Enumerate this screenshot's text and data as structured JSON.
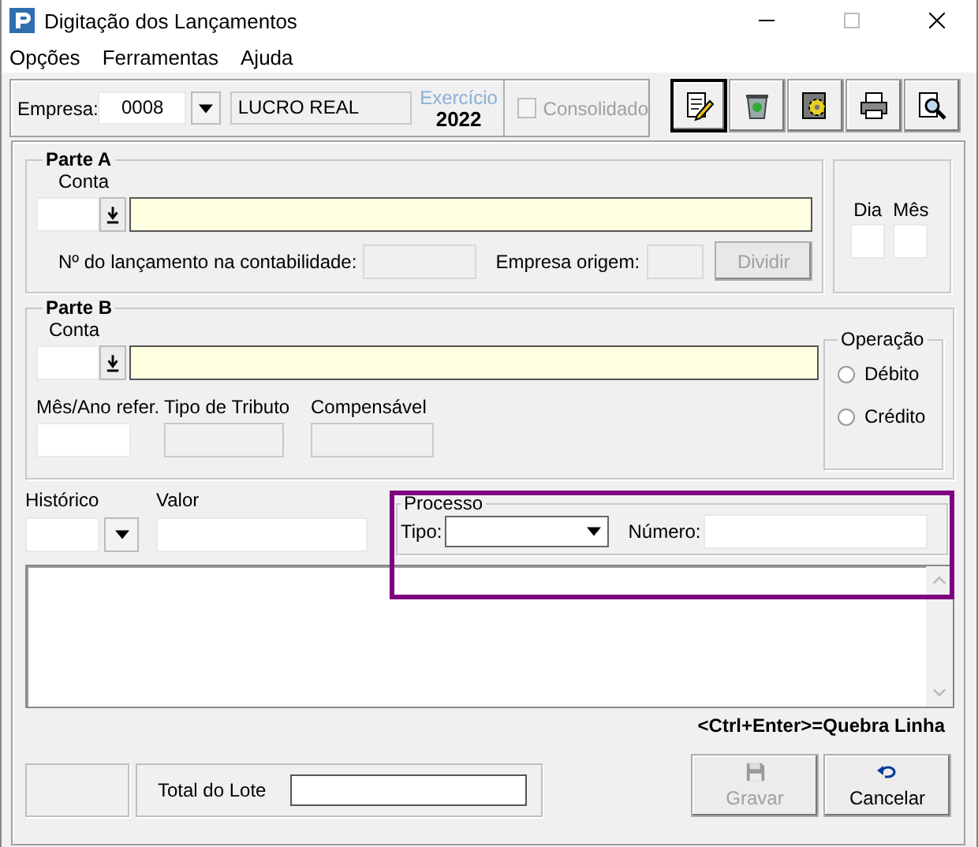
{
  "window": {
    "title": "Digitação dos Lançamentos"
  },
  "menu": [
    "Opções",
    "Ferramentas",
    "Ajuda"
  ],
  "header": {
    "empresa_label": "Empresa:",
    "empresa_value": "0008",
    "regime": "LUCRO REAL",
    "exercicio_label": "Exercício",
    "exercicio_value": "2022",
    "consolidado": {
      "label": "Consolidado",
      "checked": false,
      "disabled": true
    }
  },
  "toolbar": [
    {
      "kind": "edit",
      "selected": true
    },
    {
      "kind": "trash",
      "selected": false
    },
    {
      "kind": "gear",
      "selected": false
    },
    {
      "kind": "print",
      "selected": false
    },
    {
      "kind": "search",
      "selected": false
    }
  ],
  "parte_a": {
    "title": "Parte A",
    "conta_label": "Conta",
    "lancamento_label": "Nº do lançamento na contabilidade:",
    "empresa_origem_label": "Empresa origem:",
    "dividir": {
      "label": "Dividir",
      "disabled": true
    }
  },
  "data": {
    "dia_label": "Dia",
    "mes_label": "Mês"
  },
  "parte_b": {
    "title": "Parte B",
    "conta_label": "Conta",
    "mes_ano_label": "Mês/Ano refer.",
    "tipo_tributo_label": "Tipo de Tributo",
    "compensavel_label": "Compensável",
    "operacao": {
      "title": "Operação",
      "options": [
        {
          "label": "Débito",
          "selected": false
        },
        {
          "label": "Crédito",
          "selected": false
        }
      ]
    }
  },
  "historico_label": "Histórico",
  "valor_label": "Valor",
  "processo": {
    "title": "Processo",
    "tipo_label": "Tipo:",
    "numero_label": "Número:"
  },
  "hint": "<Ctrl+Enter>=Quebra Linha",
  "total_label": "Total do Lote",
  "buttons": [
    {
      "label": "Gravar",
      "kind": "save",
      "disabled": true
    },
    {
      "label": "Cancelar",
      "kind": "undo",
      "disabled": false
    }
  ]
}
